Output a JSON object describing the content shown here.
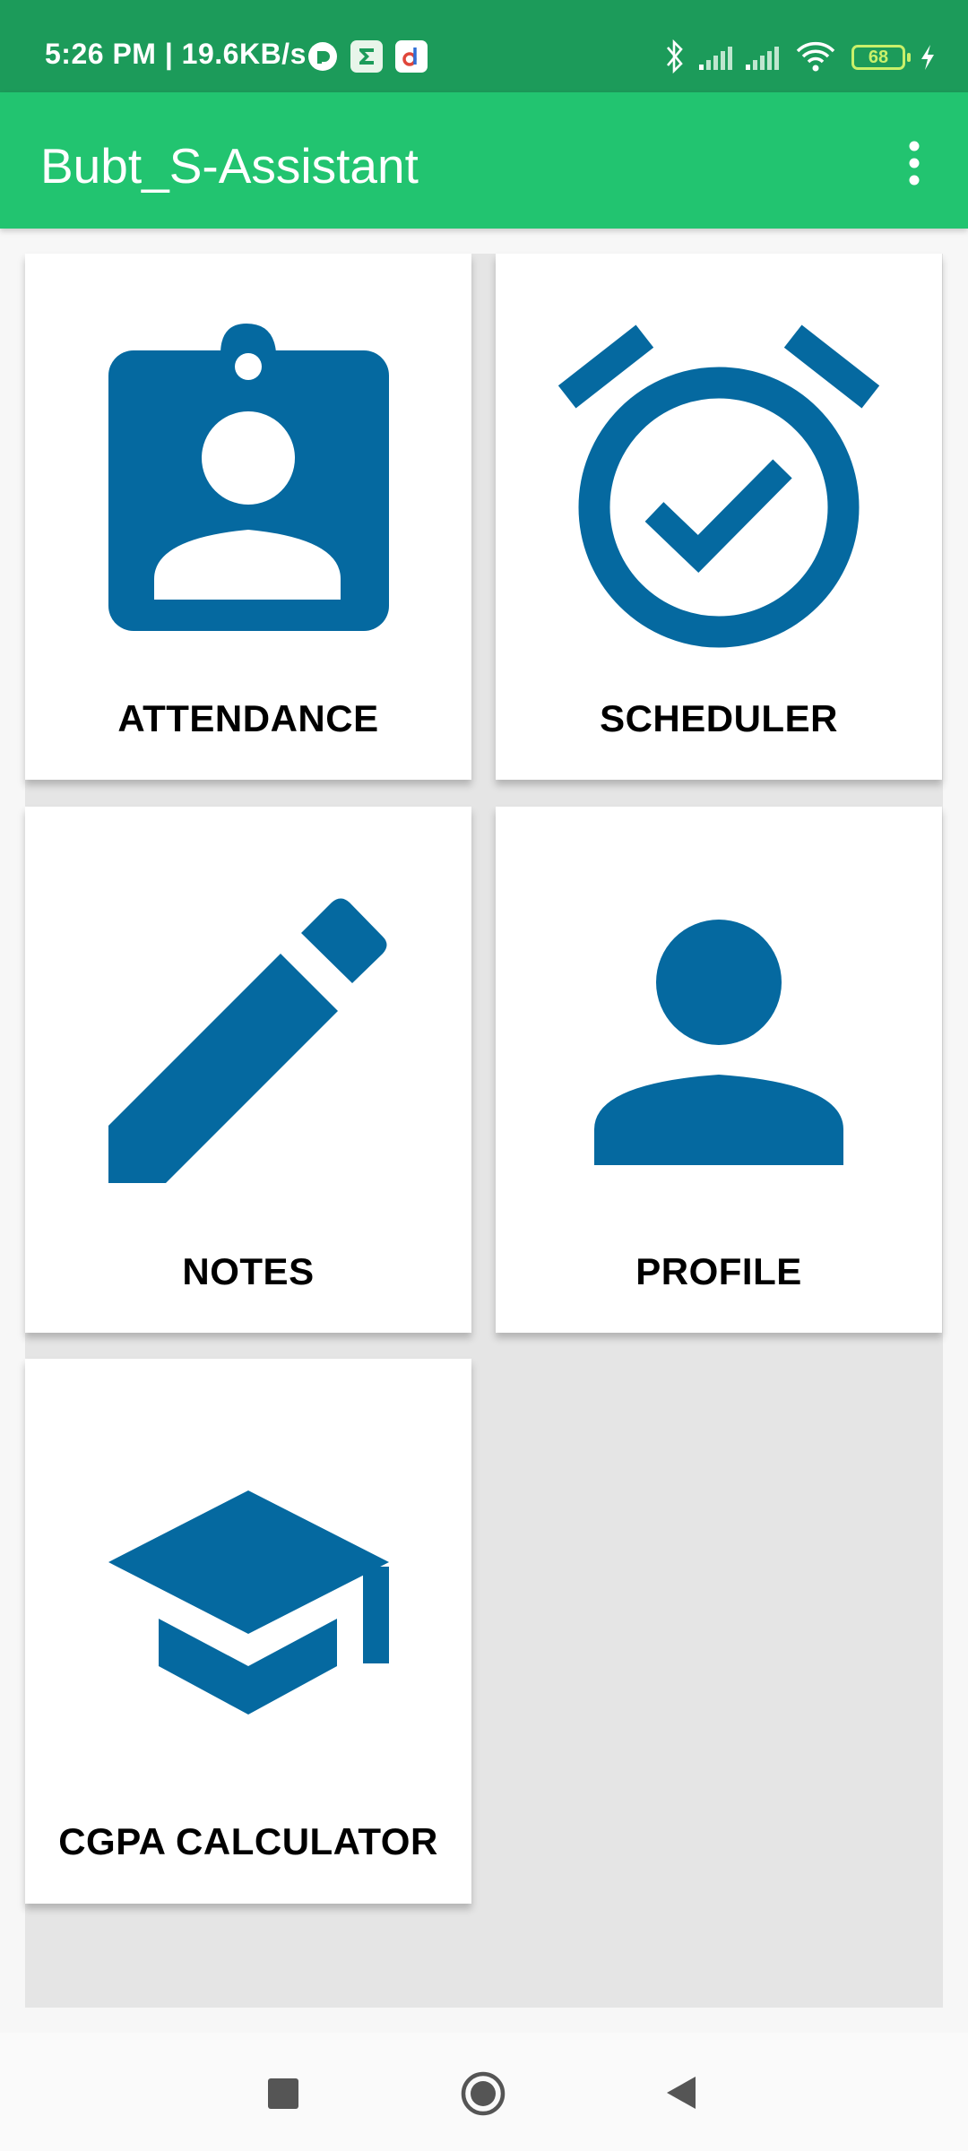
{
  "status_bar": {
    "time_speed": "5:26 PM | 19.6KB/s",
    "battery_level": "68",
    "icons": [
      "messenger-icon",
      "sigma-app-icon",
      "d-app-icon",
      "bluetooth-icon",
      "signal-icon",
      "signal-icon",
      "wifi-icon",
      "battery-icon",
      "charging-icon"
    ]
  },
  "app_bar": {
    "title": "Bubt_S-Assistant",
    "menu_icon": "more-vertical-icon"
  },
  "tiles": [
    {
      "label": "ATTENDANCE",
      "icon": "badge-icon"
    },
    {
      "label": "SCHEDULER",
      "icon": "alarm-check-icon"
    },
    {
      "label": "NOTES",
      "icon": "pencil-icon"
    },
    {
      "label": "PROFILE",
      "icon": "person-icon"
    },
    {
      "label": "CGPA CALCULATOR",
      "icon": "graduation-cap-icon"
    }
  ],
  "nav_bar": {
    "icons": [
      "recents-square-icon",
      "home-circle-icon",
      "back-triangle-icon"
    ]
  },
  "colors": {
    "status_bar": "#1c9b5a",
    "app_bar": "#22c470",
    "icon_blue": "#0569a0",
    "grid_bg": "#e5e5e5"
  }
}
